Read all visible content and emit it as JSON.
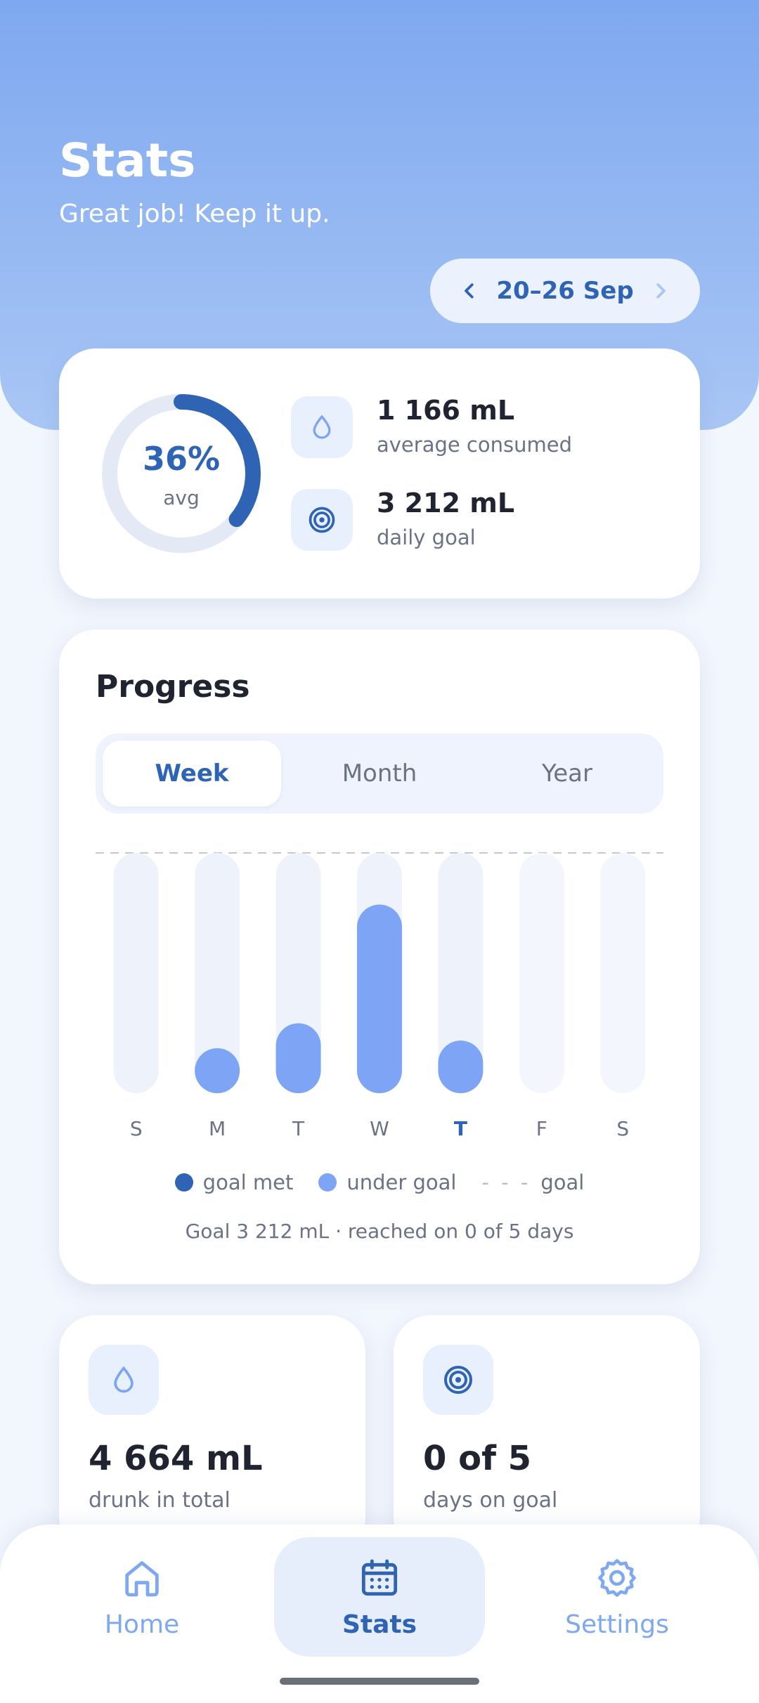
{
  "header": {
    "title": "Stats",
    "subtitle": "Great job! Keep it up.",
    "date_range": "20–26 Sep"
  },
  "summary": {
    "percent_label": "36%",
    "percent_value": 0.36,
    "percent_sub": "avg",
    "average_value": "1 166 mL",
    "average_label": "average consumed",
    "goal_value": "3 212 mL",
    "goal_label": "daily goal",
    "icons": {
      "average": "droplet-icon",
      "goal": "target-icon"
    }
  },
  "progress": {
    "title": "Progress",
    "tabs": [
      {
        "label": "Week",
        "active": true
      },
      {
        "label": "Month",
        "active": false
      },
      {
        "label": "Year",
        "active": false
      }
    ],
    "legend": {
      "met": "goal met",
      "under": "under goal",
      "goal_dash": "- - -",
      "goal": "goal"
    },
    "footnote": "Goal 3 212 mL · reached on 0 of 5 days"
  },
  "chart_data": {
    "type": "bar",
    "categories": [
      "S",
      "M",
      "T",
      "W",
      "T",
      "F",
      "S"
    ],
    "values": [
      0,
      185,
      291,
      785,
      219,
      null,
      null
    ],
    "goal": 1000,
    "ylim": [
      0,
      1000
    ],
    "today_index": 4,
    "future_indices": [
      5,
      6
    ],
    "colors": {
      "under": "#7ea5f5",
      "met": "#2f64b5",
      "track": "#eef2fb",
      "track_future": "#f3f6fc",
      "today_label": "#2f64b5",
      "label": "#6b7284"
    }
  },
  "tiles": [
    {
      "value": "4 664 mL",
      "label": "drunk in total",
      "icon": "droplet-icon"
    },
    {
      "value": "0 of 5",
      "label": "days on goal",
      "icon": "target-icon"
    }
  ],
  "nav": {
    "items": [
      {
        "label": "Home",
        "icon": "home-icon",
        "active": false
      },
      {
        "label": "Stats",
        "icon": "calendar-icon",
        "active": true
      },
      {
        "label": "Settings",
        "icon": "gear-icon",
        "active": false
      }
    ]
  },
  "colors": {
    "accent": "#2f64b5",
    "accent_light": "#7ea8ef",
    "background": "#f2f6fd"
  }
}
